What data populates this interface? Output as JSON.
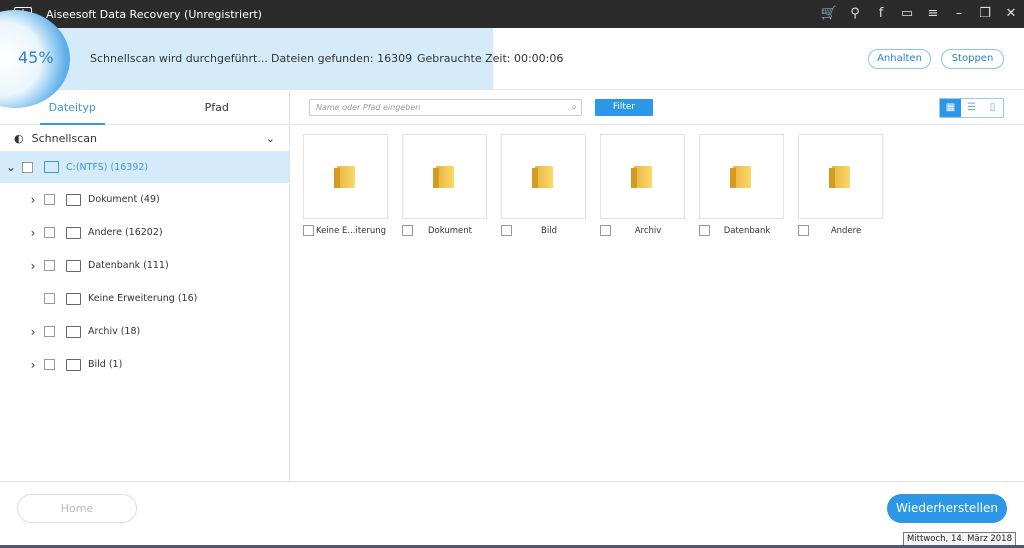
{
  "window": {
    "title": "Aiseesoft Data Recovery (Unregistriert)",
    "icons": [
      "cart-icon",
      "key-icon",
      "facebook-icon",
      "chat-icon",
      "menu-icon",
      "minimize-icon",
      "restore-icon",
      "close-icon"
    ]
  },
  "scan": {
    "percent": "45%",
    "progress": 45,
    "status": "Schnellscan wird durchgeführt...",
    "files_found": "Dateien gefunden: 16309",
    "elapsed": "Gebrauchte Zeit: 00:00:06",
    "pause": "Anhalten",
    "stop": "Stoppen"
  },
  "sidebar": {
    "tabs": [
      "Dateityp",
      "Pfad"
    ],
    "mode": "Schnellscan",
    "drive": "C:(NTFS) (16392)",
    "items": [
      {
        "label": "Dokument (49)",
        "expand": true
      },
      {
        "label": "Andere (16202)",
        "expand": true
      },
      {
        "label": "Datenbank (111)",
        "expand": true
      },
      {
        "label": "Keine Erweiterung (16)",
        "expand": false
      },
      {
        "label": "Archiv (18)",
        "expand": true
      },
      {
        "label": "Bild (1)",
        "expand": true
      }
    ]
  },
  "toolbar": {
    "search_placeholder": "Name oder Pfad eingeben",
    "filter": "Filter"
  },
  "folders": [
    "Keine E...iterung",
    "Dokument",
    "Bild",
    "Archiv",
    "Datenbank",
    "Andere"
  ],
  "footer": {
    "home": "Home",
    "restore": "Wiederherstellen",
    "tooltip": "Mittwoch, 14. März 2018"
  },
  "colors": {
    "accent": "#2b97e6",
    "progress_bg": "#d6ebf9",
    "titlebar": "#2b2b2b"
  }
}
